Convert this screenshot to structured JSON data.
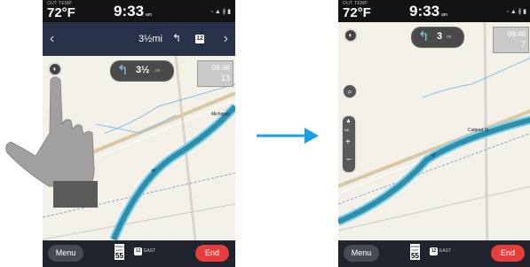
{
  "left_screen": {
    "status": {
      "temp_label": "OUT TEMP",
      "temp": "72°F",
      "time": "9:33",
      "time_suffix": "am",
      "icons": "◦ ▲ ∦ ▮"
    },
    "nav_header": {
      "prev": "‹",
      "next": "›",
      "distance": "3½mi",
      "turn_arrow": "↰",
      "route": "12"
    },
    "turn_pill": {
      "arrow": "↰",
      "distance": "3½",
      "unit": "mi"
    },
    "eta": {
      "time": "09:46",
      "distance": "13"
    },
    "road_label": "Michigan",
    "compass_icon": "compass-icon",
    "bottom": {
      "menu": "Menu",
      "speed_top": "SPEED LIMIT",
      "speed": "55",
      "route_shield": "12",
      "route_dir": "EAST",
      "end": "End"
    }
  },
  "right_screen": {
    "status": {
      "temp_label": "OUT TEMP",
      "temp": "72°F",
      "time": "9:33",
      "time_suffix": "am",
      "icons": "◦ ▲ ∦ ▮"
    },
    "turn_pill": {
      "arrow": "↰",
      "distance": "3",
      "unit": "mi"
    },
    "eta": {
      "time": "09:46",
      "distance": "7"
    },
    "road_label": "Cabinet St",
    "zoom": {
      "up": "▲",
      "ne": "NE",
      "plus": "+",
      "minus": "−"
    },
    "search_icon": "⌕",
    "bottom": {
      "menu": "Menu",
      "speed_top": "SPEED LIMIT",
      "speed": "55",
      "route_shield": "12",
      "route_dir": "EAST",
      "end": "End"
    }
  },
  "colors": {
    "route": "#2f8fa9",
    "route_outline": "#7ed0ef",
    "map_bg": "#f3f0e8",
    "header": "#27324a",
    "end_button": "#e63d3d",
    "arrow": "#18a0e0"
  }
}
